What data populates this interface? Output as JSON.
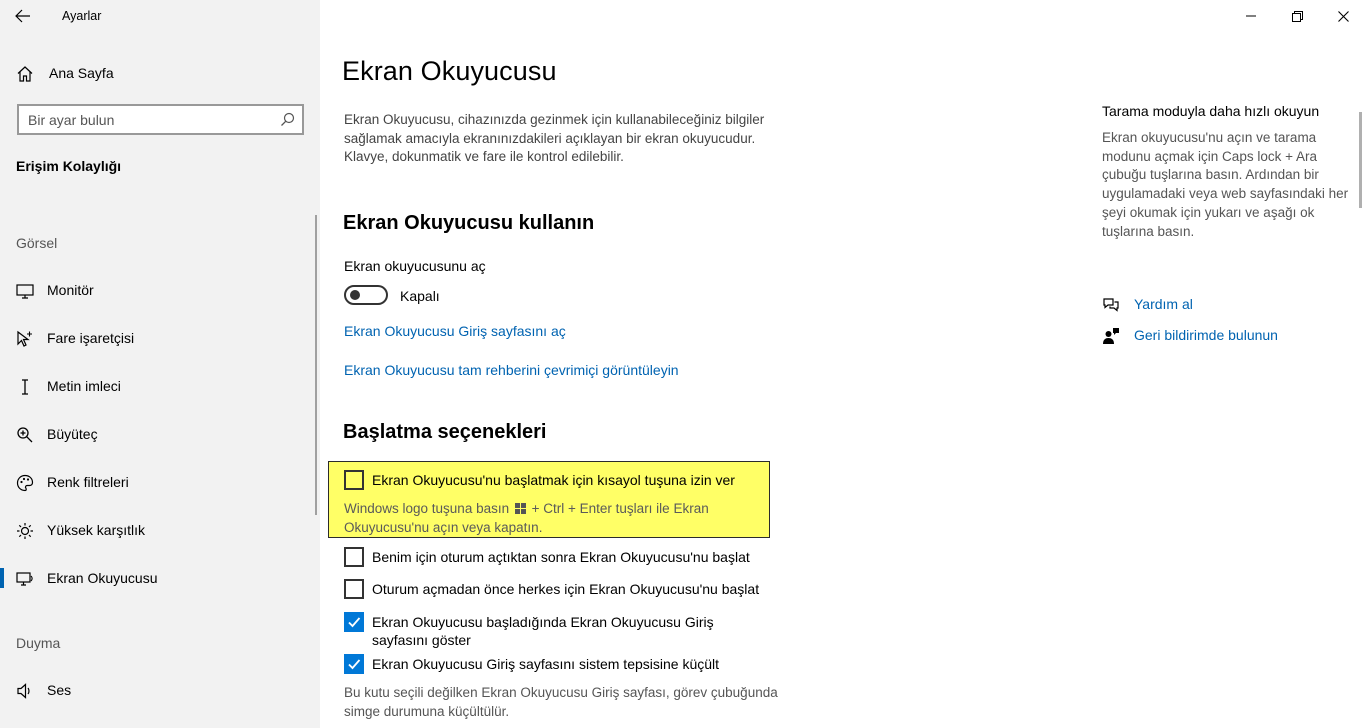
{
  "window": {
    "title": "Ayarlar",
    "controls": [
      "minimize",
      "restore",
      "close"
    ]
  },
  "sidebar": {
    "home_label": "Ana Sayfa",
    "search_placeholder": "Bir ayar bulun",
    "section_title": "Erişim Kolaylığı",
    "groups": [
      {
        "label": "Görsel",
        "items": [
          {
            "label": "Monitör",
            "icon": "monitor-icon"
          },
          {
            "label": "Fare işaretçisi",
            "icon": "mouse-pointer-icon"
          },
          {
            "label": "Metin imleci",
            "icon": "text-cursor-icon"
          },
          {
            "label": "Büyüteç",
            "icon": "magnifier-icon"
          },
          {
            "label": "Renk filtreleri",
            "icon": "palette-icon"
          },
          {
            "label": "Yüksek karşıtlık",
            "icon": "brightness-icon"
          },
          {
            "label": "Ekran Okuyucusu",
            "icon": "narrator-icon",
            "active": true
          }
        ]
      },
      {
        "label": "Duyma",
        "items": [
          {
            "label": "Ses",
            "icon": "speaker-icon"
          }
        ]
      }
    ]
  },
  "main": {
    "title": "Ekran Okuyucusu",
    "description": "Ekran Okuyucusu, cihazınızda gezinmek için kullanabileceğiniz bilgiler sağlamak amacıyla ekranınızdakileri açıklayan bir ekran okuyucudur. Klavye, dokunmatik ve fare ile kontrol edilebilir.",
    "use_section": {
      "heading": "Ekran Okuyucusu kullanın",
      "toggle_label": "Ekran okuyucusunu aç",
      "toggle_state": "Kapalı",
      "toggle_on": false,
      "links": [
        "Ekran Okuyucusu Giriş sayfasını aç",
        "Ekran Okuyucusu tam rehberini çevrimiçi görüntüleyin"
      ]
    },
    "startup_section": {
      "heading": "Başlatma seçenekleri",
      "highlight_color": "#ffff66",
      "shortcut_option": {
        "label": "Ekran Okuyucusu'nu başlatmak için kısayol tuşuna izin ver",
        "checked": false,
        "desc_part1": "Windows logo tuşuna basın",
        "desc_part2": "+ Ctrl + Enter tuşları ile Ekran Okuyucusu'nu açın veya kapatın."
      },
      "options": [
        {
          "label": "Benim için oturum açtıktan sonra Ekran Okuyucusu'nu başlat",
          "checked": false
        },
        {
          "label": "Oturum açmadan önce herkes için Ekran Okuyucusu'nu başlat",
          "checked": false
        },
        {
          "label": "Ekran Okuyucusu başladığında Ekran Okuyucusu Giriş sayfasını göster",
          "checked": true
        },
        {
          "label": "Ekran Okuyucusu Giriş sayfasını sistem tepsisine küçült",
          "checked": true
        }
      ],
      "footer_note": "Bu kutu seçili değilken Ekran Okuyucusu Giriş sayfası, görev çubuğunda simge durumuna küçültülür."
    }
  },
  "right_panel": {
    "title": "Tarama moduyla daha hızlı okuyun",
    "text": "Ekran okuyucusu'nu açın ve tarama modunu açmak için Caps lock + Ara çubuğu tuşlarına basın. Ardından bir uygulamadaki veya web sayfasındaki her şeyi okumak için yukarı ve aşağı ok tuşlarına basın.",
    "links": [
      {
        "label": "Yardım al",
        "icon": "help-chat-icon"
      },
      {
        "label": "Geri bildirimde bulunun",
        "icon": "feedback-icon"
      }
    ]
  },
  "colors": {
    "accent": "#0078d7",
    "link": "#0063b1",
    "sidebar_bg": "#f2f2f2"
  }
}
